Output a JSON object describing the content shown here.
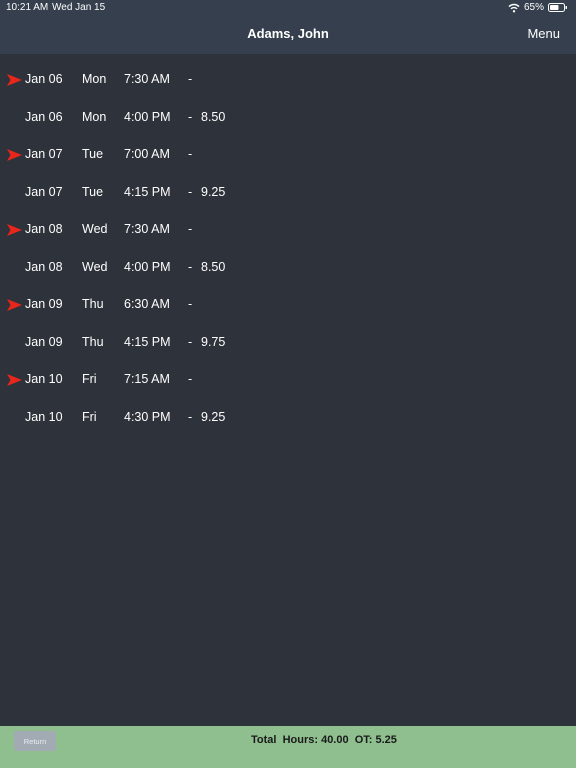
{
  "status": {
    "time": "10:21 AM",
    "date": "Wed Jan 15",
    "battery": "65%"
  },
  "header": {
    "title": "Adams, John",
    "menu_label": "Menu"
  },
  "entries": [
    {
      "flag": true,
      "date": "Jan 06",
      "day": "Mon",
      "time": "7:30 AM",
      "dash": "-",
      "hours": ""
    },
    {
      "flag": false,
      "date": "Jan 06",
      "day": "Mon",
      "time": "4:00 PM",
      "dash": "-",
      "hours": "8.50"
    },
    {
      "flag": true,
      "date": "Jan 07",
      "day": "Tue",
      "time": "7:00 AM",
      "dash": "-",
      "hours": ""
    },
    {
      "flag": false,
      "date": "Jan 07",
      "day": "Tue",
      "time": "4:15 PM",
      "dash": "-",
      "hours": "9.25"
    },
    {
      "flag": true,
      "date": "Jan 08",
      "day": "Wed",
      "time": "7:30 AM",
      "dash": "-",
      "hours": ""
    },
    {
      "flag": false,
      "date": "Jan 08",
      "day": "Wed",
      "time": "4:00 PM",
      "dash": "-",
      "hours": "8.50"
    },
    {
      "flag": true,
      "date": "Jan 09",
      "day": "Thu",
      "time": "6:30 AM",
      "dash": "-",
      "hours": ""
    },
    {
      "flag": false,
      "date": "Jan 09",
      "day": "Thu",
      "time": "4:15 PM",
      "dash": "-",
      "hours": "9.75"
    },
    {
      "flag": true,
      "date": "Jan 10",
      "day": "Fri",
      "time": "7:15 AM",
      "dash": "-",
      "hours": ""
    },
    {
      "flag": false,
      "date": "Jan 10",
      "day": "Fri",
      "time": "4:30 PM",
      "dash": "-",
      "hours": "9.25"
    }
  ],
  "footer": {
    "return_label": "Return",
    "totals_text": "Total  Hours: 40.00  OT: 5.25"
  },
  "colors": {
    "background": "#2e323a",
    "header": "#353f4d",
    "footer": "#8fbf8f",
    "arrow": "#e8261c"
  }
}
